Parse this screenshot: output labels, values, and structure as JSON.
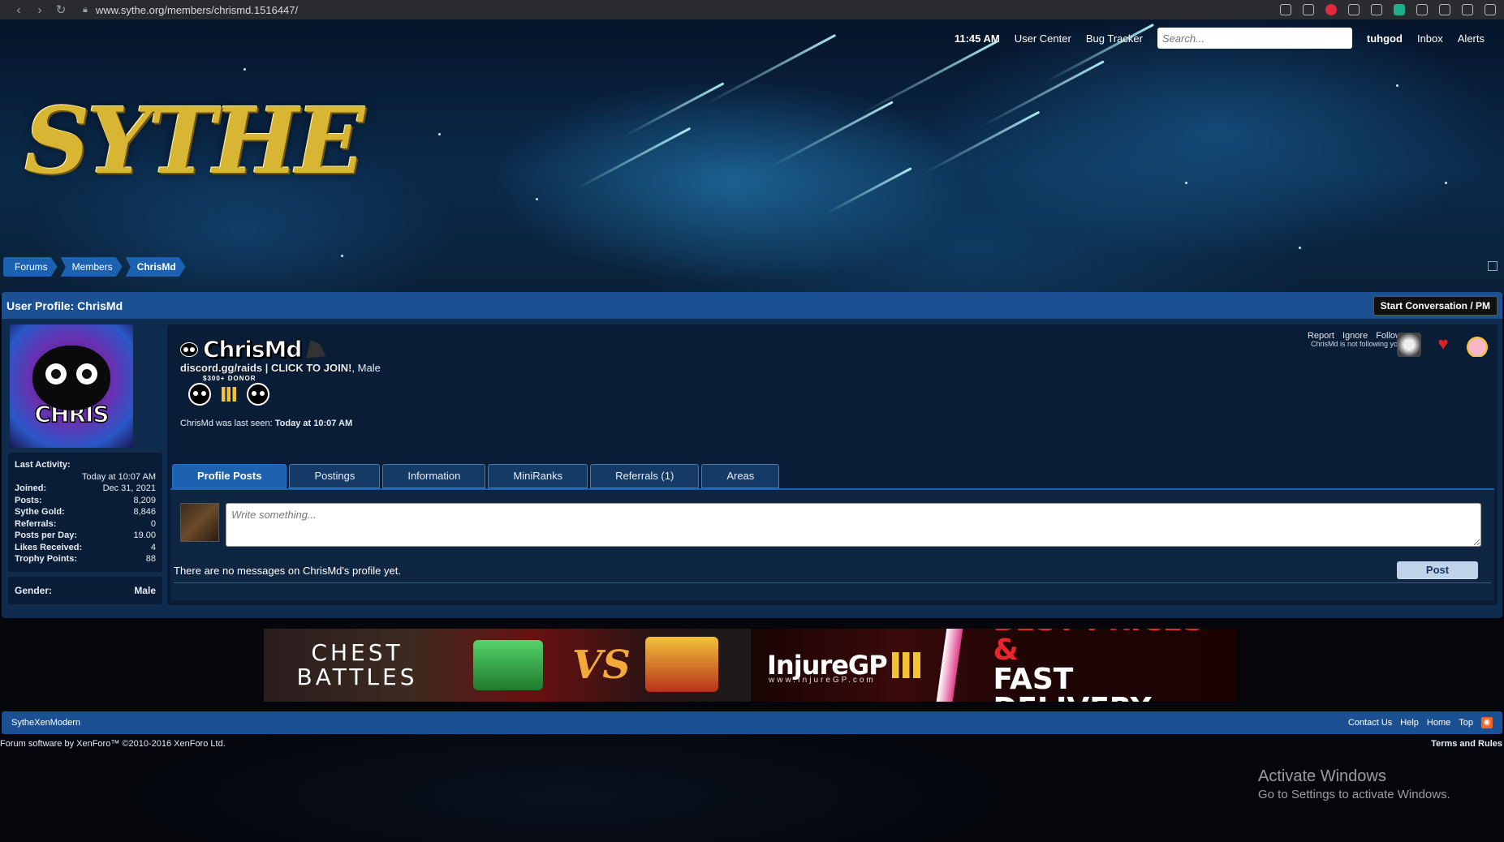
{
  "browser": {
    "url": "www.sythe.org/members/chrismd.1516447/"
  },
  "header": {
    "logo_text": "SYTHE",
    "time": "11:45 AM",
    "nav": [
      "User Center",
      "Bug Tracker"
    ],
    "search_placeholder": "Search...",
    "username": "tuhgod",
    "inbox": "Inbox",
    "alerts": "Alerts"
  },
  "breadcrumb": [
    "Forums",
    "Members",
    "ChrisMd"
  ],
  "profile": {
    "title": "User Profile: ChrisMd",
    "pm_button": "Start Conversation / PM",
    "avatar_text": "CHRIS",
    "username": "ChrisMd",
    "user_title_link": "discord.gg/raids | CLICK TO JOIN!",
    "user_title_suffix": ", Male",
    "donor_label": "$300+ DONOR",
    "last_seen_prefix": "ChrisMd was last seen:",
    "last_seen_value": "Today at 10:07 AM",
    "actions": [
      "Report",
      "Ignore",
      "Follow"
    ],
    "following_note": "ChrisMd is not following you",
    "stats": {
      "last_activity_label": "Last Activity:",
      "last_activity_value": "Today at 10:07 AM",
      "rows": [
        {
          "label": "Joined:",
          "value": "Dec 31, 2021"
        },
        {
          "label": "Posts:",
          "value": "8,209"
        },
        {
          "label": "Sythe Gold:",
          "value": "8,846"
        },
        {
          "label": "Referrals:",
          "value": "0"
        },
        {
          "label": "Posts per Day:",
          "value": "19.00"
        },
        {
          "label": "Likes Received:",
          "value": "4"
        },
        {
          "label": "Trophy Points:",
          "value": "88"
        }
      ]
    },
    "gender_label": "Gender:",
    "gender_value": "Male",
    "tabs": [
      "Profile Posts",
      "Postings",
      "Information",
      "MiniRanks",
      "Referrals (1)",
      "Areas"
    ],
    "compose_placeholder": "Write something...",
    "post_button": "Post",
    "empty_message": "There are no messages on ChrisMd's profile yet."
  },
  "ad": {
    "left_text_1": "CHEST",
    "left_text_2": "BATTLES",
    "vs": "VS",
    "brand": "InjureGP",
    "brand_url": "www.InjureGP.com",
    "tagline_1": "BEST PRICES &",
    "tagline_2": "FAST DELIVERY"
  },
  "footer": {
    "style_name": "SytheXenModern",
    "links": [
      "Contact Us",
      "Help",
      "Home",
      "Top"
    ],
    "copyright": "Forum software by XenForo™ ©2010-2016 XenForo Ltd.",
    "terms": "Terms and Rules"
  },
  "windows": {
    "title": "Activate Windows",
    "subtitle": "Go to Settings to activate Windows."
  },
  "colors": {
    "accent": "#1d62b0",
    "panel": "#0a1d36",
    "title_bar": "#1b5192"
  }
}
